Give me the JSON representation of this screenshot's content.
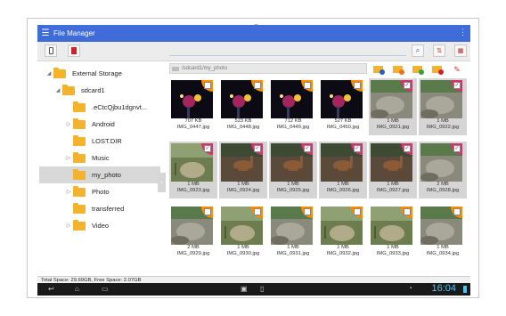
{
  "app": {
    "title": "File Manager"
  },
  "toolbar": {
    "btn_phone": "phone-icon",
    "btn_sdcard": "sdcard-icon"
  },
  "tree": {
    "items": [
      {
        "label": "External Storage",
        "arrow": "◢"
      },
      {
        "label": "sdcard1",
        "arrow": "◢"
      },
      {
        "label": ".eCtcQjbu1dgnvt...",
        "arrow": ""
      },
      {
        "label": "Android",
        "arrow": "▷"
      },
      {
        "label": "LOST.DIR",
        "arrow": ""
      },
      {
        "label": "Music",
        "arrow": "▷"
      },
      {
        "label": "my_photo",
        "arrow": ""
      },
      {
        "label": "Photo",
        "arrow": "▷"
      },
      {
        "label": "transferred",
        "arrow": ""
      },
      {
        "label": "Video",
        "arrow": "▷"
      }
    ]
  },
  "path": {
    "text": "/sdcard1/my_photo"
  },
  "files": [
    {
      "size": "707 KB",
      "name": "IMG_0447.jpg",
      "tag": "orange",
      "checked": false,
      "scene": "night"
    },
    {
      "size": "523 KB",
      "name": "IMG_0448.jpg",
      "tag": "orange",
      "checked": false,
      "scene": "night"
    },
    {
      "size": "712 KB",
      "name": "IMG_0449.jpg",
      "tag": "orange",
      "checked": false,
      "scene": "night"
    },
    {
      "size": "527 KB",
      "name": "IMG_0450.jpg",
      "tag": "orange",
      "checked": false,
      "scene": "night"
    },
    {
      "size": "1 MB",
      "name": "IMG_0921.jpg",
      "tag": "pink",
      "checked": true,
      "scene": "rocks"
    },
    {
      "size": "1 MB",
      "name": "IMG_0922.jpg",
      "tag": "pink",
      "checked": true,
      "scene": "rocks"
    },
    {
      "size": "1 MB",
      "name": "IMG_0923.jpg",
      "tag": "pink",
      "checked": true,
      "scene": "grass"
    },
    {
      "size": "1 MB",
      "name": "IMG_0924.jpg",
      "tag": "pink",
      "checked": true,
      "scene": "deer"
    },
    {
      "size": "1 MB",
      "name": "IMG_0925.jpg",
      "tag": "pink",
      "checked": true,
      "scene": "deer"
    },
    {
      "size": "1 MB",
      "name": "IMG_0926.jpg",
      "tag": "pink",
      "checked": true,
      "scene": "deer"
    },
    {
      "size": "1 MB",
      "name": "IMG_0927.jpg",
      "tag": "pink",
      "checked": true,
      "scene": "deer"
    },
    {
      "size": "2 MB",
      "name": "IMG_0928.jpg",
      "tag": "pink",
      "checked": true,
      "scene": "rocks"
    },
    {
      "size": "2 MB",
      "name": "IMG_0929.jpg",
      "tag": "orange",
      "checked": false,
      "scene": "rocks"
    },
    {
      "size": "1 MB",
      "name": "IMG_0930.jpg",
      "tag": "orange",
      "checked": false,
      "scene": "grass"
    },
    {
      "size": "1 MB",
      "name": "IMG_0931.jpg",
      "tag": "orange",
      "checked": false,
      "scene": "rocks"
    },
    {
      "size": "1 MB",
      "name": "IMG_0932.jpg",
      "tag": "orange",
      "checked": false,
      "scene": "grass"
    },
    {
      "size": "1 MB",
      "name": "IMG_0933.jpg",
      "tag": "orange",
      "checked": false,
      "scene": "grass"
    },
    {
      "size": "1 MB",
      "name": "IMG_0934.jpg",
      "tag": "orange",
      "checked": false,
      "scene": "rocks"
    }
  ],
  "status": {
    "text": "Total Space: 29.69GB, Free Space: 2.07GB"
  },
  "system": {
    "clock": "16:04"
  },
  "colors": {
    "appbar": "#3f6cd8",
    "tag_orange": "#ff8a00",
    "tag_pink": "#d0346a",
    "clock": "#4ec3ee"
  }
}
